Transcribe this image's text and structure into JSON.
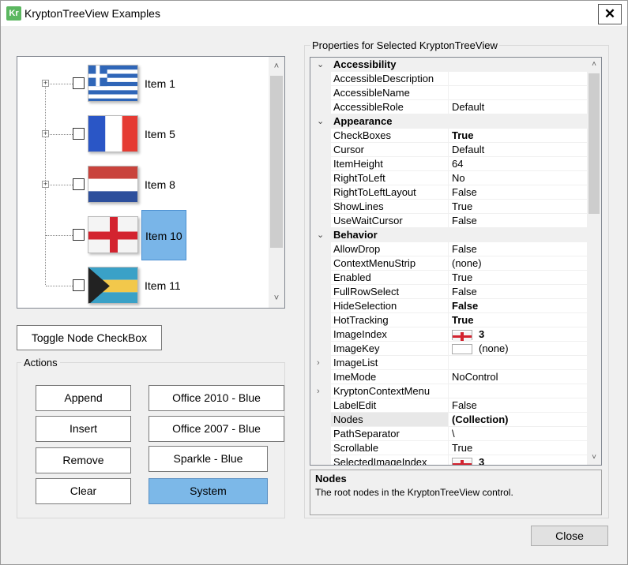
{
  "window": {
    "title": "KryptonTreeView Examples",
    "icon_text": "Kr",
    "close_glyph": "✕"
  },
  "tree": {
    "nodes": [
      {
        "label": "Item 1",
        "flag": "greece",
        "expandable": true,
        "selected": false
      },
      {
        "label": "Item 5",
        "flag": "france",
        "expandable": true,
        "selected": false
      },
      {
        "label": "Item 8",
        "flag": "netherlands",
        "expandable": true,
        "selected": false
      },
      {
        "label": "Item 10",
        "flag": "england",
        "expandable": false,
        "selected": true
      },
      {
        "label": "Item 11",
        "flag": "bahamas",
        "expandable": false,
        "selected": false
      }
    ],
    "expand_glyph": "+",
    "scroll_up": "˄",
    "scroll_down": "˅"
  },
  "buttons": {
    "toggle": "Toggle Node CheckBox",
    "append": "Append",
    "insert": "Insert",
    "remove": "Remove",
    "clear": "Clear",
    "office2010": "Office 2010 - Blue",
    "office2007": "Office 2007 - Blue",
    "sparkle": "Sparkle - Blue",
    "system": "System",
    "close": "Close"
  },
  "actions_group": {
    "title": "Actions"
  },
  "props": {
    "title": "Properties for Selected KryptonTreeView",
    "rows": [
      {
        "type": "cat",
        "name": "Accessibility"
      },
      {
        "name": "AccessibleDescription",
        "value": ""
      },
      {
        "name": "AccessibleName",
        "value": ""
      },
      {
        "name": "AccessibleRole",
        "value": "Default"
      },
      {
        "type": "cat",
        "name": "Appearance"
      },
      {
        "name": "CheckBoxes",
        "value": "True",
        "bold": true
      },
      {
        "name": "Cursor",
        "value": "Default"
      },
      {
        "name": "ItemHeight",
        "value": "64"
      },
      {
        "name": "RightToLeft",
        "value": "No"
      },
      {
        "name": "RightToLeftLayout",
        "value": "False"
      },
      {
        "name": "ShowLines",
        "value": "True"
      },
      {
        "name": "UseWaitCursor",
        "value": "False"
      },
      {
        "type": "cat",
        "name": "Behavior"
      },
      {
        "name": "AllowDrop",
        "value": "False"
      },
      {
        "name": "ContextMenuStrip",
        "value": "(none)"
      },
      {
        "name": "Enabled",
        "value": "True"
      },
      {
        "name": "FullRowSelect",
        "value": "False"
      },
      {
        "name": "HideSelection",
        "value": "False",
        "bold": true
      },
      {
        "name": "HotTracking",
        "value": "True",
        "bold": true
      },
      {
        "name": "ImageIndex",
        "value": "3",
        "bold": true,
        "thumb": "england"
      },
      {
        "name": "ImageKey",
        "value": "(none)",
        "thumb": "blank"
      },
      {
        "name": "ImageList",
        "value": "",
        "expandable": true
      },
      {
        "name": "ImeMode",
        "value": "NoControl"
      },
      {
        "name": "KryptonContextMenu",
        "value": "",
        "expandable": true
      },
      {
        "name": "LabelEdit",
        "value": "False"
      },
      {
        "name": "Nodes",
        "value": "(Collection)",
        "bold": true,
        "selected": true
      },
      {
        "name": "PathSeparator",
        "value": "\\"
      },
      {
        "name": "Scrollable",
        "value": "True"
      },
      {
        "name": "SelectedImageIndex",
        "value": "3",
        "bold": true,
        "thumb": "england"
      }
    ],
    "cat_glyph": "⌄",
    "expand_glyph": "›"
  },
  "help": {
    "title": "Nodes",
    "description": "The root nodes in the KryptonTreeView control."
  },
  "colors": {
    "selection": "#79b5e8",
    "system_button": "#7cb8e8",
    "app_icon": "#5bb760"
  }
}
